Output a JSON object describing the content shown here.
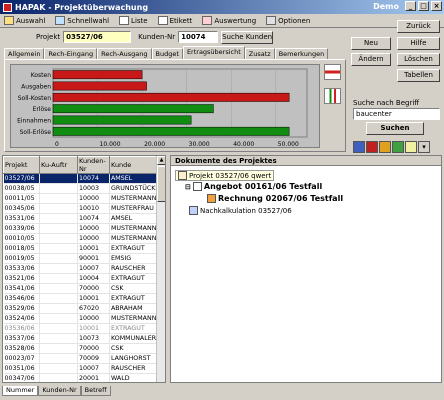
{
  "window": {
    "title": "HAPAK - Projektüberwachung",
    "badge": "Demo"
  },
  "menu": [
    "Auswahl",
    "Schnellwahl",
    "Liste",
    "Etikett",
    "Auswertung",
    "Optionen"
  ],
  "fields": {
    "projekt_label": "Projekt",
    "projekt_value": "03527/06",
    "kunden_label": "Kunden-Nr",
    "kunden_value": "10074",
    "suche_kunden": "Suche Kunden"
  },
  "tabs": [
    "Allgemein",
    "Rech-Eingang",
    "Rech-Ausgang",
    "Budget",
    "Ertragsübersicht",
    "Zusatz",
    "Bemerkungen"
  ],
  "active_tab": "Ertragsübersicht",
  "chart_data": {
    "type": "bar",
    "orientation": "horizontal",
    "categories": [
      "Kosten",
      "Ausgaben",
      "Soll-Kosten",
      "Erlöse",
      "Einnahmen",
      "Soll-Erlöse"
    ],
    "values": [
      20000,
      21000,
      53000,
      36000,
      31000,
      53000
    ],
    "colors": [
      "#c81818",
      "#c81818",
      "#c81818",
      "#108c10",
      "#108c10",
      "#108c10"
    ],
    "xticks": [
      "0",
      "10.000",
      "20.000",
      "30.000",
      "40.000",
      "50.000"
    ],
    "xlim": [
      0,
      57000
    ]
  },
  "right_buttons": {
    "zurueck": "Zurück",
    "neu": "Neu",
    "hilfe": "Hilfe",
    "aendern": "Ändern",
    "loeschen": "Löschen",
    "tabellen": "Tabellen",
    "search_label": "Suche nach Begriff",
    "search_value": "baucenter",
    "suchen": "Suchen"
  },
  "grid": {
    "headers": [
      "Projekt",
      "Ku-Auftr",
      "Kunden-Nr",
      "Kunde"
    ],
    "rows": [
      [
        "03527/06",
        "",
        "10074",
        "AMSEL"
      ],
      [
        "00038/05",
        "",
        "10003",
        "GRUNDSTÜCKSVE"
      ],
      [
        "00011/05",
        "",
        "10000",
        "MUSTERMANN"
      ],
      [
        "00345/06",
        "",
        "10010",
        "MUSTERFRAU"
      ],
      [
        "03531/06",
        "",
        "10074",
        "AMSEL"
      ],
      [
        "00339/06",
        "",
        "10000",
        "MUSTERMANN"
      ],
      [
        "00010/05",
        "",
        "10000",
        "MUSTERMANN"
      ],
      [
        "00018/05",
        "",
        "10001",
        "EXTRAGUT"
      ],
      [
        "00019/05",
        "",
        "90001",
        "EMSIG"
      ],
      [
        "03533/06",
        "",
        "10007",
        "RAUSCHER"
      ],
      [
        "03521/06",
        "",
        "10004",
        "EXTRAGUT"
      ],
      [
        "03541/06",
        "",
        "70000",
        "CSK"
      ],
      [
        "03546/06",
        "",
        "10001",
        "EXTRAGUT"
      ],
      [
        "03529/06",
        "",
        "67020",
        "ABRAHAM"
      ],
      [
        "03524/06",
        "",
        "10000",
        "MUSTERMANN"
      ],
      [
        "03536/06",
        "",
        "10001",
        "EXTRAGUT"
      ],
      [
        "03537/06",
        "",
        "10073",
        "KOMMUNALER IM"
      ],
      [
        "03528/06",
        "",
        "70000",
        "CSK"
      ],
      [
        "00023/07",
        "",
        "70009",
        "LANGHORST"
      ],
      [
        "00351/06",
        "",
        "10007",
        "RAUSCHER"
      ],
      [
        "00347/06",
        "",
        "20001",
        "WALD"
      ]
    ]
  },
  "docs": {
    "header": "Dokumente des Projektes",
    "root": "Projekt 03527/06 qwert",
    "angebot": "Angebot 00161/06 Testfall",
    "rechnung": "Rechnung 02067/06 Testfall",
    "nachkalk": "Nachkalkulation 03527/06"
  },
  "bottom_tabs": [
    "Nummer",
    "Kunden-Nr",
    "Betreff"
  ]
}
